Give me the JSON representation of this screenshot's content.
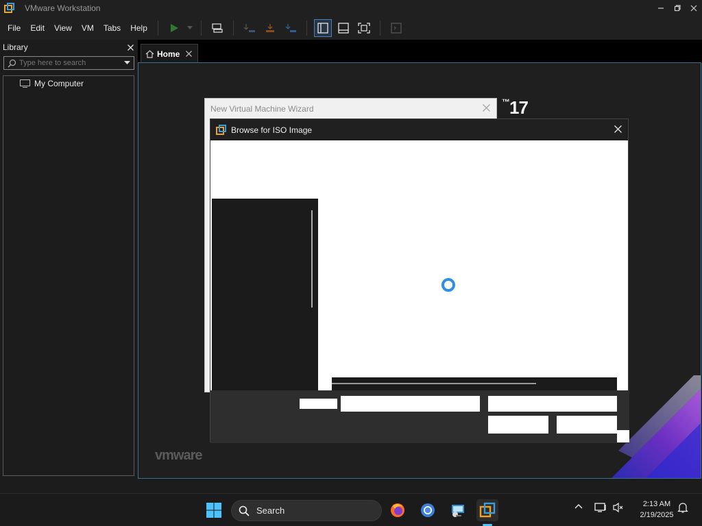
{
  "window": {
    "title": "VMware Workstation",
    "controls": [
      "minimize",
      "restore",
      "close"
    ]
  },
  "menu": {
    "file": "File",
    "edit": "Edit",
    "view": "View",
    "vm": "VM",
    "tabs": "Tabs",
    "help": "Help"
  },
  "toolbar_icons": [
    "play-icon",
    "dropdown-icon",
    "send-keys-icon",
    "suspend-icon",
    "revert-icon",
    "snapshot-manager-icon",
    "library-toggle-icon",
    "thumbnail-bar-icon",
    "fullscreen-icon",
    "console-view-icon"
  ],
  "library": {
    "title": "Library",
    "search_placeholder": "Type here to search",
    "items": [
      {
        "label": "My Computer",
        "icon": "computer-icon"
      }
    ]
  },
  "tabs": [
    {
      "label": "Home",
      "icon": "home-icon",
      "active": true
    }
  ],
  "home": {
    "product_version": "17",
    "brand": "vmware"
  },
  "wizard": {
    "title": "New Virtual Machine Wizard"
  },
  "browse_dialog": {
    "title": "Browse for ISO Image",
    "loading": true
  },
  "taskbar": {
    "search_label": "Search",
    "apps": [
      "windows-start-icon",
      "firefox-icon",
      "chrome-icon",
      "remote-desktop-icon",
      "vmware-workstation-icon"
    ],
    "clock_time": "2:13 AM",
    "clock_date": "2/19/2025"
  },
  "colors": {
    "accent_blue": "#3c9ddc",
    "accent_orange": "#f2a31b",
    "dark_bg": "#1f1f1f",
    "spinner": "#2f8fe0"
  }
}
